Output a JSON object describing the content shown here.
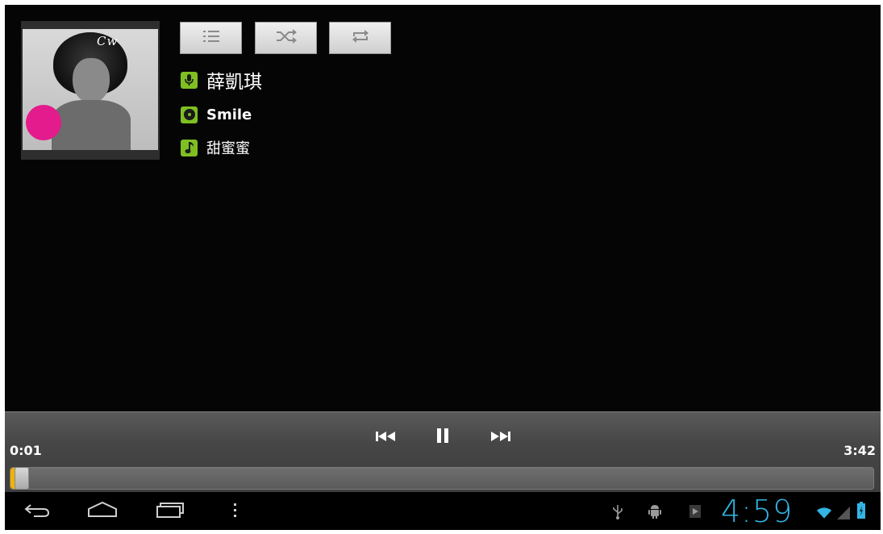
{
  "track": {
    "artist": "薛凱琪",
    "album": "Smile",
    "title": "甜蜜蜜"
  },
  "album_art": {
    "logo_text": "Cw"
  },
  "toolbar": {
    "playlist_icon": "playlist-icon",
    "shuffle_icon": "shuffle-icon",
    "repeat_icon": "repeat-icon"
  },
  "player": {
    "elapsed": "0:01",
    "duration": "3:42",
    "progress_fraction": 0.005
  },
  "status_bar": {
    "clock": "4:59"
  },
  "colors": {
    "accent_green": "#7fbf22",
    "clock_blue": "#33b5e5",
    "seek_fill": "#f0b400"
  }
}
